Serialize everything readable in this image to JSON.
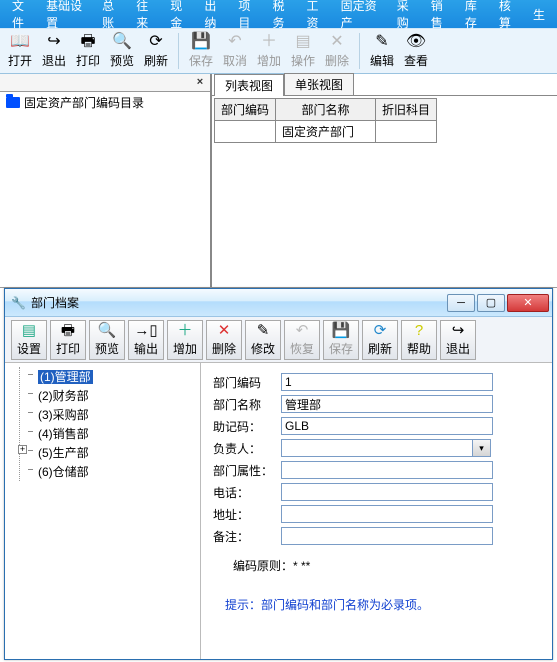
{
  "menu": [
    "文件",
    "基础设置",
    "总账",
    "往来",
    "现金",
    "出纳",
    "项目",
    "税务",
    "工资",
    "固定资产",
    "采购",
    "销售",
    "库存",
    "核算",
    "生"
  ],
  "toolbar_main": {
    "open": "打开",
    "exit": "退出",
    "print": "打印",
    "preview": "预览",
    "refresh": "刷新",
    "save": "保存",
    "cancel": "取消",
    "add": "增加",
    "action": "操作",
    "delete": "删除",
    "edit": "编辑",
    "view": "查看"
  },
  "left_tree_title": "固定资产部门编码目录",
  "tabs": {
    "list": "列表视图",
    "single": "单张视图"
  },
  "table": {
    "headers": [
      "部门编码",
      "部门名称",
      "折旧科目"
    ],
    "row": [
      "",
      "固定资产部门",
      ""
    ]
  },
  "dialog": {
    "title": "部门档案",
    "toolbar": {
      "setup": "设置",
      "print": "打印",
      "preview": "预览",
      "export": "输出",
      "add": "增加",
      "delete": "删除",
      "edit": "修改",
      "undo": "恢复",
      "save": "保存",
      "refresh": "刷新",
      "help": "帮助",
      "exit": "退出"
    },
    "tree": [
      {
        "label": "(1)管理部",
        "selected": true
      },
      {
        "label": "(2)财务部"
      },
      {
        "label": "(3)采购部"
      },
      {
        "label": "(4)销售部"
      },
      {
        "label": "(5)生产部",
        "expand": "+"
      },
      {
        "label": "(6)仓储部"
      }
    ],
    "form": {
      "code_label": "部门编码",
      "code_value": "1",
      "name_label": "部门名称",
      "name_value": "管理部",
      "mnemonic_label": "助记码：",
      "mnemonic_value": "GLB",
      "owner_label": "负责人：",
      "owner_value": "",
      "attr_label": "部门属性：",
      "attr_value": "",
      "phone_label": "电话：",
      "phone_value": "",
      "addr_label": "地址：",
      "addr_value": "",
      "note_label": "备注：",
      "note_value": ""
    },
    "rule_label": "编码原则：* **",
    "hint": "提示：部门编码和部门名称为必录项。"
  }
}
